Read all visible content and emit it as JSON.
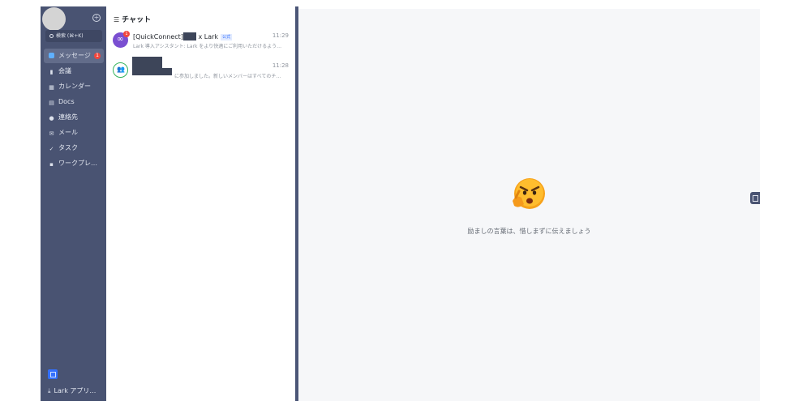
{
  "sidebar": {
    "search_label": "検索 (⌘+K)",
    "items": [
      {
        "label": "メッセージ",
        "icon": "message-icon",
        "badge": "1"
      },
      {
        "label": "会議",
        "icon": "video-icon"
      },
      {
        "label": "カレンダー",
        "icon": "calendar-icon"
      },
      {
        "label": "Docs",
        "icon": "docs-icon"
      },
      {
        "label": "連絡先",
        "icon": "contacts-icon"
      },
      {
        "label": "メール",
        "icon": "mail-icon"
      },
      {
        "label": "タスク",
        "icon": "check-icon"
      },
      {
        "label": "ワークプレ…",
        "icon": "grid-icon"
      }
    ],
    "lark_app_label": "Lark アプリ…"
  },
  "chatlist": {
    "title": "チャット",
    "chats": [
      {
        "name_prefix": "[QuickConnect]",
        "name_suffix": " x Lark",
        "tag": "公式",
        "time": "11:29",
        "preview": "Lark 導入アシスタント: Lark をより快適にご利用いただけるよう…",
        "badge": "1"
      },
      {
        "time": "11:28",
        "preview": "に参加しました。新しいメンバーはすべてのチ…"
      }
    ]
  },
  "main": {
    "empty_message": "励ましの言葉は、惜しまずに伝えましょう"
  },
  "colors": {
    "sidebar_bg": "#495372",
    "accent": "#3370ff",
    "badge": "#f2463c",
    "main_bg": "#f6f7f9"
  }
}
